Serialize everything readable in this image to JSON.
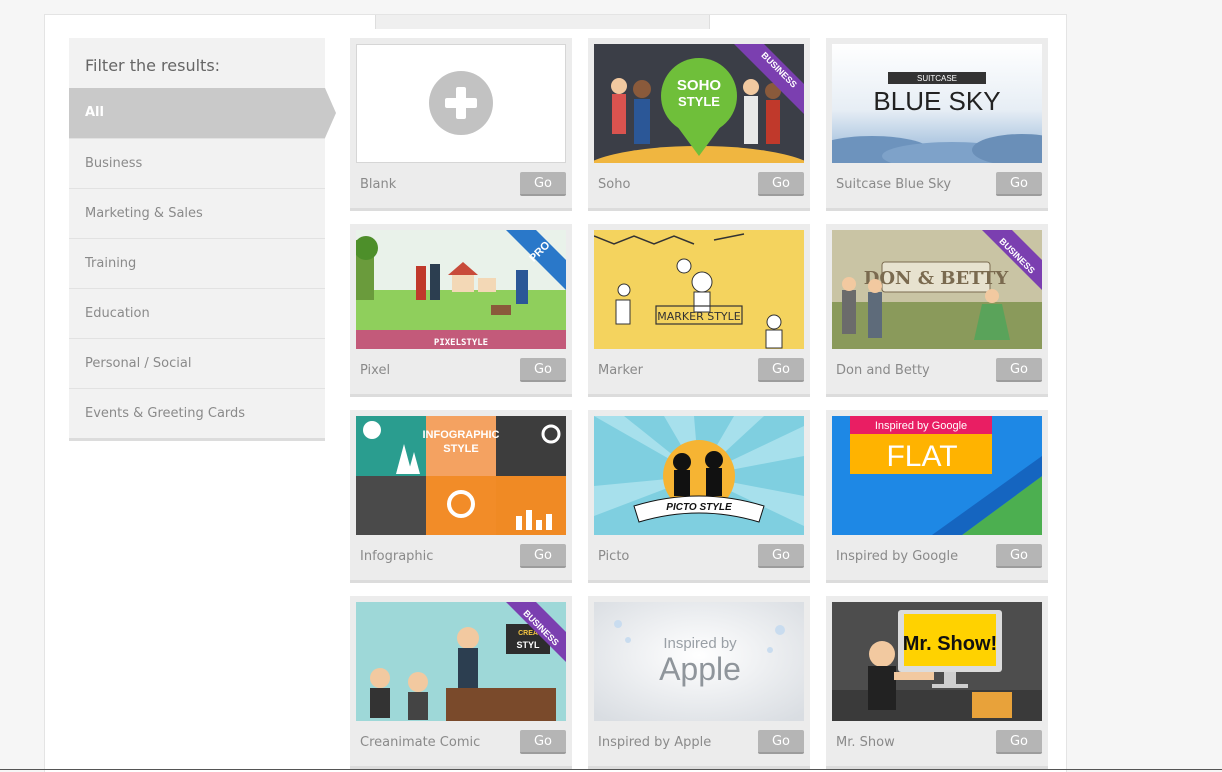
{
  "sidebar": {
    "title": "Filter the results:",
    "items": [
      {
        "label": "All",
        "active": true
      },
      {
        "label": "Business"
      },
      {
        "label": "Marketing & Sales"
      },
      {
        "label": "Training"
      },
      {
        "label": "Education"
      },
      {
        "label": "Personal / Social"
      },
      {
        "label": "Events & Greeting Cards"
      }
    ]
  },
  "go_label": "Go",
  "templates": [
    {
      "name": "Blank"
    },
    {
      "name": "Soho",
      "thumb_text": [
        "SOHO",
        "STYLE"
      ],
      "ribbon": "BUSINESS"
    },
    {
      "name": "Suitcase Blue Sky",
      "thumb_text": [
        "SUITCASE",
        "BLUE SKY"
      ]
    },
    {
      "name": "Pixel",
      "thumb_text": [
        "PIXELSTYLE"
      ],
      "ribbon": "PRO"
    },
    {
      "name": "Marker",
      "thumb_text": [
        "MARKER STYLE"
      ]
    },
    {
      "name": "Don and Betty",
      "thumb_text": [
        "DON & BETTY"
      ],
      "ribbon": "BUSINESS"
    },
    {
      "name": "Infographic",
      "thumb_text": [
        "INFOGRAPHIC",
        "STYLE"
      ]
    },
    {
      "name": "Picto",
      "thumb_text": [
        "PICTO STYLE"
      ]
    },
    {
      "name": "Inspired by Google",
      "thumb_text": [
        "Inspired by Google",
        "FLAT"
      ]
    },
    {
      "name": "Creanimate Comic",
      "thumb_text": [
        "CREA",
        "STYL"
      ],
      "ribbon": "BUSINESS"
    },
    {
      "name": "Inspired by Apple",
      "thumb_text": [
        "Inspired by",
        "Apple"
      ]
    },
    {
      "name": "Mr. Show",
      "thumb_text": [
        "Mr. Show!"
      ]
    }
  ],
  "colors": {
    "business_ribbon": "#7b3fb0",
    "pro_ribbon": "#2a78c9",
    "soho_pin": "#6fbf3a",
    "google_blue": "#1e88e5",
    "google_orange": "#ffb300",
    "google_pink": "#e91e63",
    "google_green": "#4caf50"
  }
}
